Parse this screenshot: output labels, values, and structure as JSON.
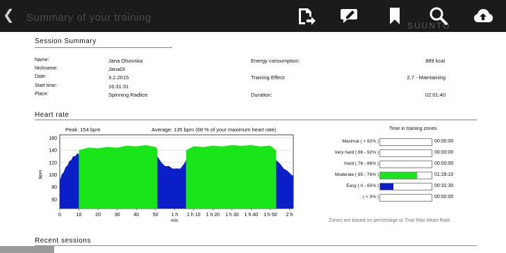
{
  "toolbar": {
    "back_icon": "chevron-left-icon",
    "title": "Summary of your training",
    "brand": "SUUNTO",
    "icons": [
      "share-doc-icon",
      "annotate-comment-icon",
      "bookmark-icon",
      "search-icon",
      "cloud-upload-icon"
    ]
  },
  "session": {
    "title": "Session Summary",
    "rows": [
      {
        "label": "Name:",
        "value": "Jana Olsovska"
      },
      {
        "label": "Nickname:",
        "value": "JanaOl"
      },
      {
        "label": "Date:",
        "value": "3.2.2015"
      },
      {
        "label": "Start time:",
        "value": "16:31:31"
      },
      {
        "label": "Place:",
        "value": "Spinning Radlice"
      }
    ],
    "right_rows": [
      {
        "label": "Energy consumption:",
        "value": "889 kcal"
      },
      {
        "label": "Training Effect:",
        "value": "2,7 - Maintaining"
      },
      {
        "label": "Duration:",
        "value": "02:01:40"
      }
    ]
  },
  "heart_rate": {
    "title": "Heart rate",
    "peak": "Peak: 154 bpm",
    "average": "Average: 135 bpm (68 % of your maximum heart rate)",
    "zones_title": "Time in training zones",
    "zones": [
      {
        "label": "Maximal (  > 92% )",
        "time": "00:00:00",
        "fill": 0,
        "color": "#19e619"
      },
      {
        "label": "Very hard ( 86 - 92% )",
        "time": "00:00:00",
        "fill": 0,
        "color": "#19e619"
      },
      {
        "label": "Hard ( 76 - 86% )",
        "time": "00:00:00",
        "fill": 0,
        "color": "#19e619"
      },
      {
        "label": "Moderate ( 65 - 76% )",
        "time": "01:28:10",
        "fill": 0.72,
        "color": "#19e619"
      },
      {
        "label": "Easy ( 0 - 65% )",
        "time": "00:31:30",
        "fill": 0.26,
        "color": "#0a1fc8"
      },
      {
        "label": ". (  < 0% )",
        "time": "00:00:00",
        "fill": 0,
        "color": "#19e619"
      }
    ],
    "footnote": "Zones are based on percentage or True Max Heart Rate."
  },
  "recent": {
    "title": "Recent sessions"
  },
  "chart_data": {
    "type": "area",
    "title": "",
    "xlabel": "min",
    "ylabel": "bpm",
    "ylim": [
      45,
      165
    ],
    "xlim": [
      0,
      122
    ],
    "y_ticks": [
      "60",
      "80",
      "100",
      "120",
      "140",
      "160"
    ],
    "x_ticks": [
      "0",
      "10",
      "20",
      "30",
      "40",
      "50",
      "1 h",
      "1 h 10",
      "1 h 20",
      "1 h 30",
      "1 h 40",
      "1 h 50",
      "2 h"
    ],
    "grid": true,
    "series": [
      {
        "color": "#0a1fc8",
        "x": [
          0,
          1,
          2,
          3,
          4,
          5,
          6,
          7,
          8,
          9,
          10
        ],
        "y": [
          90,
          98,
          104,
          110,
          115,
          120,
          124,
          128,
          130,
          132,
          134
        ]
      },
      {
        "color": "#19e619",
        "x": [
          10,
          15,
          20,
          25,
          30,
          35,
          40,
          45,
          50,
          51
        ],
        "y": [
          140,
          142,
          143,
          143,
          144,
          145,
          146,
          146,
          145,
          140
        ]
      },
      {
        "color": "#0a1fc8",
        "x": [
          51,
          53,
          55,
          57,
          59,
          61,
          63,
          65,
          66
        ],
        "y": [
          130,
          118,
          114,
          112,
          110,
          108,
          110,
          116,
          124
        ]
      },
      {
        "color": "#19e619",
        "x": [
          66,
          70,
          75,
          80,
          85,
          90,
          95,
          100,
          105,
          110,
          113
        ],
        "y": [
          140,
          144,
          145,
          145,
          146,
          146,
          147,
          146,
          146,
          145,
          140
        ]
      },
      {
        "color": "#0a1fc8",
        "x": [
          113,
          115,
          117,
          119,
          121,
          122
        ],
        "y": [
          124,
          116,
          110,
          104,
          100,
          96
        ]
      }
    ]
  }
}
